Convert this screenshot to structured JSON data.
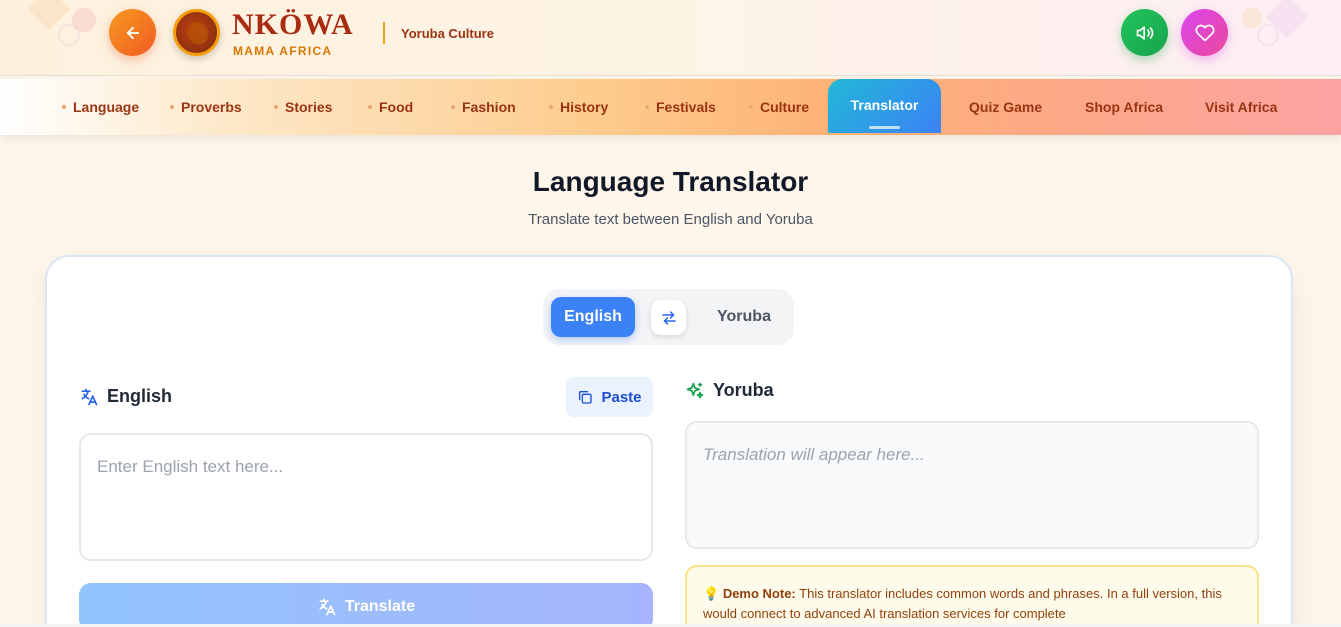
{
  "header": {
    "brand_name": "NKÖWA",
    "brand_subtitle": "MAMA AFRICA",
    "section": "Yoruba Culture"
  },
  "nav": {
    "items": [
      {
        "label": "Language"
      },
      {
        "label": "Proverbs"
      },
      {
        "label": "Stories"
      },
      {
        "label": "Food"
      },
      {
        "label": "Fashion"
      },
      {
        "label": "History"
      },
      {
        "label": "Festivals"
      },
      {
        "label": "Culture"
      },
      {
        "label": "Translator",
        "active": true
      },
      {
        "label": "Quiz Game"
      },
      {
        "label": "Shop Africa"
      },
      {
        "label": "Visit Africa"
      }
    ]
  },
  "page": {
    "title": "Language Translator",
    "subtitle": "Translate text between English and Yoruba"
  },
  "switcher": {
    "source": "English",
    "target": "Yoruba"
  },
  "source_panel": {
    "label": "English",
    "paste_label": "Paste",
    "placeholder": "Enter English text here...",
    "value": ""
  },
  "target_panel": {
    "label": "Yoruba",
    "placeholder": "Translation will appear here..."
  },
  "translate_button": {
    "label": "Translate"
  },
  "demo_note": {
    "title": "Demo Note:",
    "text": "This translator includes common words and phrases. In a full version, this would connect to advanced AI translation services for complete"
  },
  "colors": {
    "accent_blue": "#3b82f6",
    "brand_red": "#a92b12",
    "brand_orange": "#f59e0b",
    "success_green": "#16a34a"
  },
  "icons": {
    "back": "arrow-left-icon",
    "sound": "speaker-icon",
    "favorite": "heart-icon",
    "swap": "swap-arrows-icon",
    "translate": "translate-icon",
    "sparkles": "sparkles-icon",
    "copy": "copy-icon",
    "bulb": "lightbulb-icon"
  }
}
